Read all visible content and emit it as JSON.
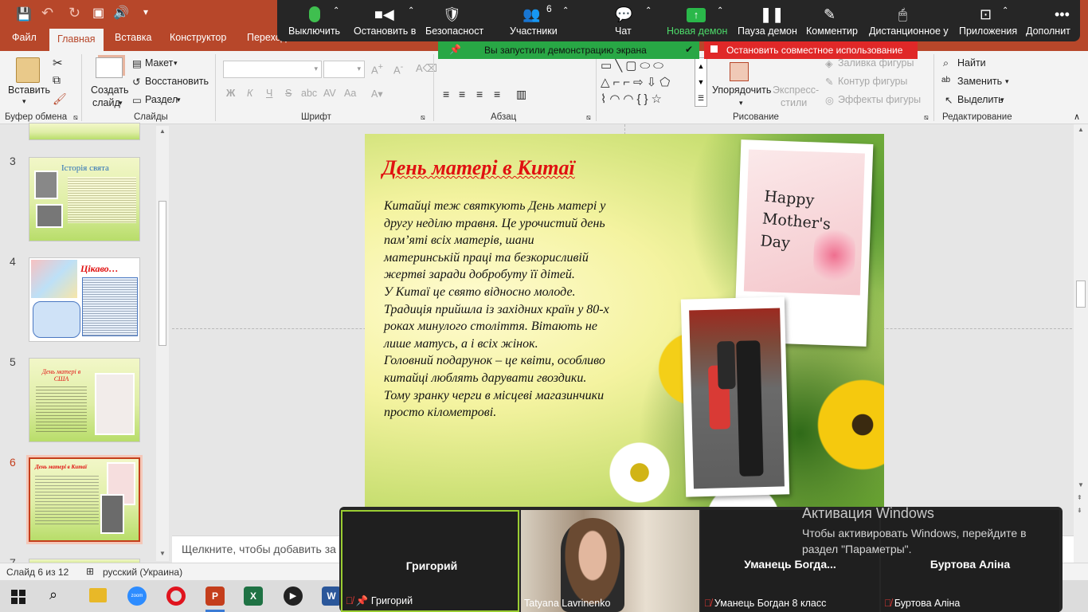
{
  "app": {
    "brand_color": "#b7472a"
  },
  "ribbon_tabs": [
    "Файл",
    "Главная",
    "Вставка",
    "Конструктор",
    "Переходы"
  ],
  "ribbon": {
    "clipboard": {
      "paste": "Вставить",
      "group": "Буфер обмена"
    },
    "slides": {
      "new_slide": "Создать",
      "new_slide2": "слайд",
      "layout": "Макет",
      "reset": "Восстановить",
      "section": "Раздел",
      "group": "Слайды"
    },
    "font": {
      "group": "Шрифт",
      "bold": "Ж",
      "italic": "К",
      "underline": "Ч",
      "strike": "S",
      "shadow": "abc"
    },
    "paragraph": {
      "group": "Абзац"
    },
    "drawing": {
      "arrange": "Упорядочить",
      "quick_styles": "Экспресс-",
      "quick_styles2": "стили",
      "fill": "Заливка фигуры",
      "outline": "Контур фигуры",
      "effects": "Эффекты фигуры",
      "group": "Рисование"
    },
    "editing": {
      "find": "Найти",
      "replace": "Заменить",
      "select": "Выделить",
      "group": "Редактирование"
    }
  },
  "zoom": {
    "buttons": [
      "Выключить",
      "Остановить в",
      "Безопасност",
      "Участники",
      "Чат",
      "Новая демон",
      "Пауза демон",
      "Комментир",
      "Дистанционное у",
      "Приложения",
      "Дополнит"
    ],
    "participants_count": "6",
    "share_notice": "Вы запустили демонстрацию экрана",
    "stop_share": "Остановить совместное использование",
    "tiles": [
      {
        "big": "Григорий",
        "label": "Григорий"
      },
      {
        "big": "",
        "label": "Tatyana Lavrinenko"
      },
      {
        "big": "Уманець  Богда...",
        "label": "Уманець Богдан 8 класс"
      },
      {
        "big": "Буртова Аліна",
        "label": "Буртова Аліна"
      }
    ]
  },
  "thumbs": [
    {
      "num": "3",
      "title": "Історія свята"
    },
    {
      "num": "4",
      "title": "Цікаво…"
    },
    {
      "num": "5",
      "title": "День матері в США"
    },
    {
      "num": "6",
      "title": "День матері  в Китаї"
    },
    {
      "num": "7",
      "title": ""
    }
  ],
  "slide": {
    "title": "День матері  в Китаї",
    "body": [
      "Китайці теж святкують День матері у",
      "другу неділю травня. Це урочистий день",
      "пам’яті всіх матерів, шани",
      "материнській праці та безкорисливій",
      "жертві заради добробуту її дітей.",
      "У Китаї це свято відносно молоде.",
      "Традиція прийшла із західних країн у 80-х",
      "роках минулого століття. Вітають не",
      "лише матусь, а і всіх жінок.",
      "Головний подарунок – це квіти, особливо",
      "китайці люблять дарувати гвоздики.",
      "Тому зранку черги в місцеві магазинчики",
      "просто кілометрові."
    ],
    "card_text": "Happy Mother's Day"
  },
  "notes_placeholder": "Щелкните, чтобы добавить за",
  "status": {
    "slide": "Слайд 6 из 12",
    "lang": "русский (Украина)"
  },
  "activation": {
    "title": "Активация Windows",
    "line1": "Чтобы активировать Windows, перейдите в",
    "line2": "раздел \"Параметры\"."
  }
}
